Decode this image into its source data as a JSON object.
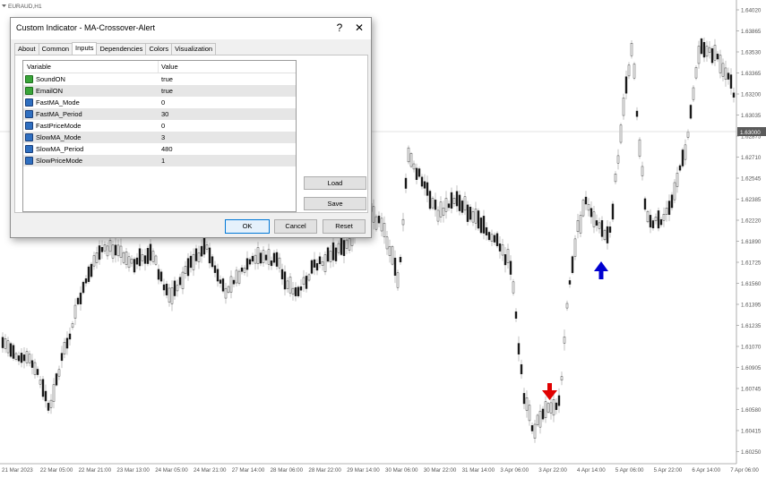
{
  "chart": {
    "symbol_label": "EURAUD,H1",
    "current_price": "1.63000",
    "price_ticks": [
      "1.64020",
      "1.63865",
      "1.63530",
      "1.63365",
      "1.63200",
      "1.63035",
      "1.62875",
      "1.62710",
      "1.62545",
      "1.62385",
      "1.62220",
      "1.61890",
      "1.61725",
      "1.61560",
      "1.61395",
      "1.61235",
      "1.61070",
      "1.60905",
      "1.60745",
      "1.60580",
      "1.60415",
      "1.60250"
    ],
    "time_ticks": [
      "21 Mar 2023",
      "22 Mar 05:00",
      "22 Mar 21:00",
      "23 Mar 13:00",
      "24 Mar 05:00",
      "24 Mar 21:00",
      "27 Mar 14:00",
      "28 Mar 06:00",
      "28 Mar 22:00",
      "29 Mar 14:00",
      "30 Mar 06:00",
      "30 Mar 22:00",
      "31 Mar 14:00",
      "3 Apr 06:00",
      "3 Apr 22:00",
      "4 Apr 14:00",
      "5 Apr 06:00",
      "5 Apr 22:00",
      "6 Apr 14:00",
      "7 Apr 06:00"
    ],
    "sell_arrow": "sell-arrow-icon",
    "buy_arrow": "buy-arrow-icon",
    "colors": {
      "sell": "#e00000",
      "buy": "#0000d0",
      "candle": "#000000"
    }
  },
  "dialog": {
    "title": "Custom Indicator - MA-Crossover-Alert",
    "help": "?",
    "close": "✕",
    "tabs": [
      "About",
      "Common",
      "Inputs",
      "Dependencies",
      "Colors",
      "Visualization"
    ],
    "active_tab": "Inputs",
    "grid": {
      "headers": [
        "Variable",
        "Value"
      ],
      "rows": [
        {
          "name": "SoundON",
          "value": "true",
          "type": "bool"
        },
        {
          "name": "EmailON",
          "value": "true",
          "type": "bool"
        },
        {
          "name": "FastMA_Mode",
          "value": "0",
          "type": "num"
        },
        {
          "name": "FastMA_Period",
          "value": "30",
          "type": "num"
        },
        {
          "name": "FastPriceMode",
          "value": "0",
          "type": "num"
        },
        {
          "name": "SlowMA_Mode",
          "value": "3",
          "type": "num"
        },
        {
          "name": "SlowMA_Period",
          "value": "480",
          "type": "num"
        },
        {
          "name": "SlowPriceMode",
          "value": "1",
          "type": "num"
        }
      ]
    },
    "load": "Load",
    "save": "Save",
    "ok": "OK",
    "cancel": "Cancel",
    "reset": "Reset"
  }
}
